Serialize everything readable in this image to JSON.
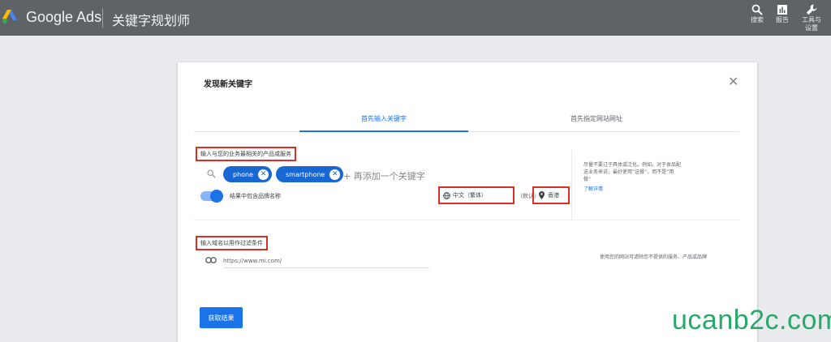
{
  "topbar": {
    "brand": "Google Ads",
    "app_title": "关键字规划师",
    "tools": [
      {
        "label": "搜索",
        "icon": "search-icon"
      },
      {
        "label": "报告",
        "icon": "bar-chart-icon"
      },
      {
        "label_line1": "工具与",
        "label_line2": "设置",
        "icon": "wrench-icon"
      }
    ],
    "colors": {
      "bar": "#5f6368"
    }
  },
  "dialog": {
    "title": "发现新关键字",
    "close_icon": "close-icon",
    "tabs": [
      {
        "label": "首先输入关键字",
        "active": true
      },
      {
        "label": "首先指定网站网址",
        "active": false
      }
    ],
    "keyword_section": {
      "label": "输入与您的业务最相关的产品或服务",
      "chips": [
        "phone",
        "smartphone"
      ],
      "add_placeholder": "+ 再添加一个关键字",
      "toggle_label": "结果中包含品牌名称",
      "toggle_on": true,
      "language": "中文（繁体）",
      "language_default": "（默认）",
      "location": "香港",
      "help_text": "尽量不要过于具体或泛化。例如，对于食品配送业务来说，最好使用“送餐”，而不是“用餐”",
      "help_link": "了解详情"
    },
    "domain_section": {
      "label": "输入域名以用作过滤条件",
      "url_value": "https://www.mi.com/",
      "help_text": "使用您的网站可滤除您不提供的服务、产品或品牌"
    },
    "submit_label": "获取结果"
  },
  "watermark": "ucanb2c.com",
  "colors": {
    "accent": "#1a73e8",
    "highlight": "#d93025",
    "watermark": "#2aa86a"
  }
}
